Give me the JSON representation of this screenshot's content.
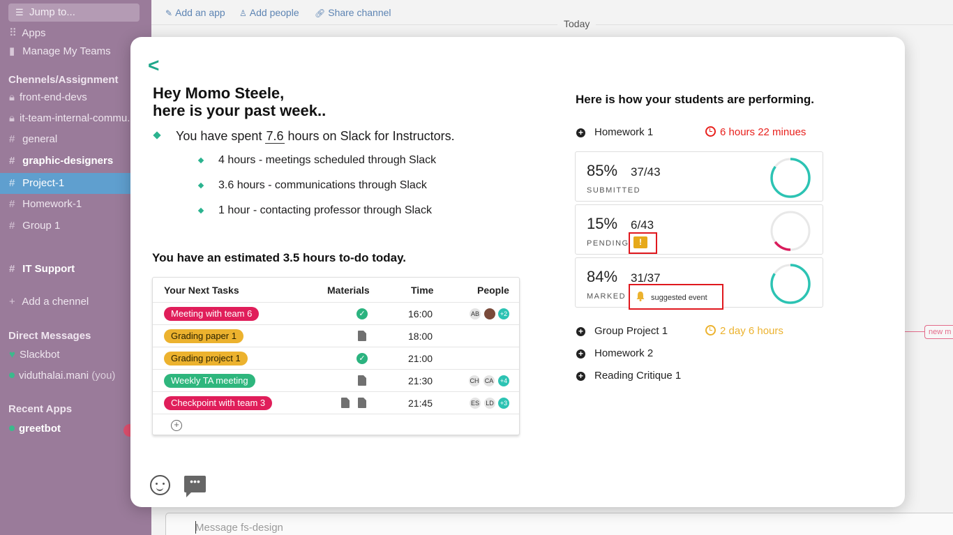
{
  "sidebar": {
    "jump_placeholder": "Jump to...",
    "apps": "Apps",
    "manage_teams": "Manage My Teams",
    "channels_header": "Chennels/Assignment",
    "channels": [
      "front-end-devs",
      "it-team-internal-commu...",
      "general",
      "graphic-designers",
      "Project-1",
      "Homework-1",
      "Group 1"
    ],
    "it_support": "IT Support",
    "add_channel": "Add a chennel",
    "dm_header": "Direct Messages",
    "dms": [
      {
        "name": "Slackbot",
        "suffix": ""
      },
      {
        "name": "viduthalai.mani",
        "suffix": "(you)"
      }
    ],
    "recent_header": "Recent Apps",
    "recent_apps": [
      "greetbot"
    ]
  },
  "topbar": {
    "add_app": "Add an app",
    "add_people": "Add people",
    "share_channel": "Share channel",
    "today": "Today",
    "new_messages": "new m"
  },
  "composer": {
    "placeholder": "Message fs-design"
  },
  "modal": {
    "greeting_line1": "Hey Momo Steele,",
    "greeting_line2": "here is your past week..",
    "spent_prefix": "You have spent",
    "spent_hours": "7.6",
    "spent_suffix": "hours on Slack for Instructors.",
    "breakdown": [
      "4 hours - meetings scheduled through Slack",
      "3.6 hours - communications through Slack",
      "1 hour - contacting professor through Slack"
    ],
    "todo": "You have an estimated 3.5 hours to-do today.",
    "table_headers": {
      "tasks": "Your Next Tasks",
      "materials": "Materials",
      "time": "Time",
      "people": "People"
    },
    "tasks": [
      {
        "name": "Meeting with team 6",
        "color": "#e01e5a",
        "time": "16:00",
        "people": [
          "AB"
        ],
        "more": "+2"
      },
      {
        "name": "Grading paper 1",
        "color": "#ecb22e",
        "time": "18:00",
        "people": [],
        "more": ""
      },
      {
        "name": "Grading project 1",
        "color": "#ecb22e",
        "time": "21:00",
        "people": [],
        "more": ""
      },
      {
        "name": "Weekly TA meeting",
        "color": "#2eb67d",
        "time": "21:30",
        "people": [
          "CH",
          "CA"
        ],
        "more": "+4"
      },
      {
        "name": "Checkpoint with team 3",
        "color": "#e01e5a",
        "time": "21:45",
        "people": [
          "ES",
          "LD"
        ],
        "more": "+3"
      }
    ],
    "add_task_icon": "plus-circle-icon",
    "performance_title": "Here is how your students are performing.",
    "assignments": [
      {
        "name": "Homework 1",
        "deadline": "6 hours 22 minues",
        "deadline_color": "#e8201c"
      },
      {
        "name": "Group Project 1",
        "deadline": "2 day 6 hours",
        "deadline_color": "#ecb22e"
      },
      {
        "name": "Homework 2",
        "deadline": ""
      },
      {
        "name": "Reading Critique 1",
        "deadline": ""
      }
    ],
    "stats": [
      {
        "percent": "85%",
        "ratio": "37/43",
        "label": "SUBMITTED",
        "fraction": 0.85,
        "color": "#2cc3b3"
      },
      {
        "percent": "15%",
        "ratio": "6/43",
        "label": "PENDING",
        "fraction": 0.15,
        "color": "#d91c5c"
      },
      {
        "percent": "84%",
        "ratio": "31/37",
        "label": "MARKED",
        "fraction": 0.84,
        "color": "#2cc3b3"
      }
    ],
    "warning_glyph": "!",
    "suggested_event": "suggested event"
  }
}
